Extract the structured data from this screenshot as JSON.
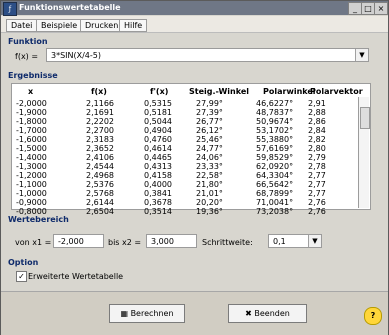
{
  "window": {
    "title": "Funktionswertetabelle",
    "controls": {
      "minimize": "_",
      "maximize": "□",
      "close": "×"
    }
  },
  "menu": [
    "Datei",
    "Beispiele",
    "Drucken",
    "Hilfe"
  ],
  "sections": {
    "function": "Funktion",
    "results": "Ergebnisse",
    "range": "Wertebereich",
    "option": "Option"
  },
  "function": {
    "label": "f(x) =",
    "value": "3*SIN(X/4-5)"
  },
  "table": {
    "columns": [
      "x",
      "f(x)",
      "f'(x)",
      "Steig.-Winkel",
      "Polarwinkel",
      "Polarvektor"
    ],
    "rows": [
      [
        "-2,0000",
        "2,1166",
        "0,5315",
        "27,99°",
        "46,6227°",
        "2,91"
      ],
      [
        "-1,9000",
        "2,1691",
        "0,5181",
        "27,39°",
        "48,7837°",
        "2,88"
      ],
      [
        "-1,8000",
        "2,2202",
        "0,5044",
        "26,77°",
        "50,9674°",
        "2,86"
      ],
      [
        "-1,7000",
        "2,2700",
        "0,4904",
        "26,12°",
        "53,1702°",
        "2,84"
      ],
      [
        "-1,6000",
        "2,3183",
        "0,4760",
        "25,46°",
        "55,3880°",
        "2,82"
      ],
      [
        "-1,5000",
        "2,3652",
        "0,4614",
        "24,77°",
        "57,6169°",
        "2,80"
      ],
      [
        "-1,4000",
        "2,4106",
        "0,4465",
        "24,06°",
        "59,8529°",
        "2,79"
      ],
      [
        "-1,3000",
        "2,4544",
        "0,4313",
        "23,33°",
        "62,0920°",
        "2,78"
      ],
      [
        "-1,2000",
        "2,4968",
        "0,4158",
        "22,58°",
        "64,3304°",
        "2,77"
      ],
      [
        "-1,1000",
        "2,5376",
        "0,4000",
        "21,80°",
        "66,5642°",
        "2,77"
      ],
      [
        "-1,0000",
        "2,5768",
        "0,3841",
        "21,01°",
        "68,7899°",
        "2,77"
      ],
      [
        "-0,9000",
        "2,6144",
        "0,3678",
        "20,20°",
        "71,0041°",
        "2,76"
      ],
      [
        "-0,8000",
        "2,6504",
        "0,3514",
        "19,36°",
        "73,2038°",
        "2,76"
      ]
    ]
  },
  "range": {
    "x1_label": "von x1 =",
    "x1_value": "-2,000",
    "x2_label": "bis x2 =",
    "x2_value": "3,000",
    "step_label": "Schrittweite:",
    "step_value": "0,1"
  },
  "option": {
    "checkbox_label": "Erweiterte Wertetabelle",
    "checked": true
  },
  "buttons": {
    "compute": "Berechnen",
    "exit": "Beenden",
    "help": "?"
  }
}
